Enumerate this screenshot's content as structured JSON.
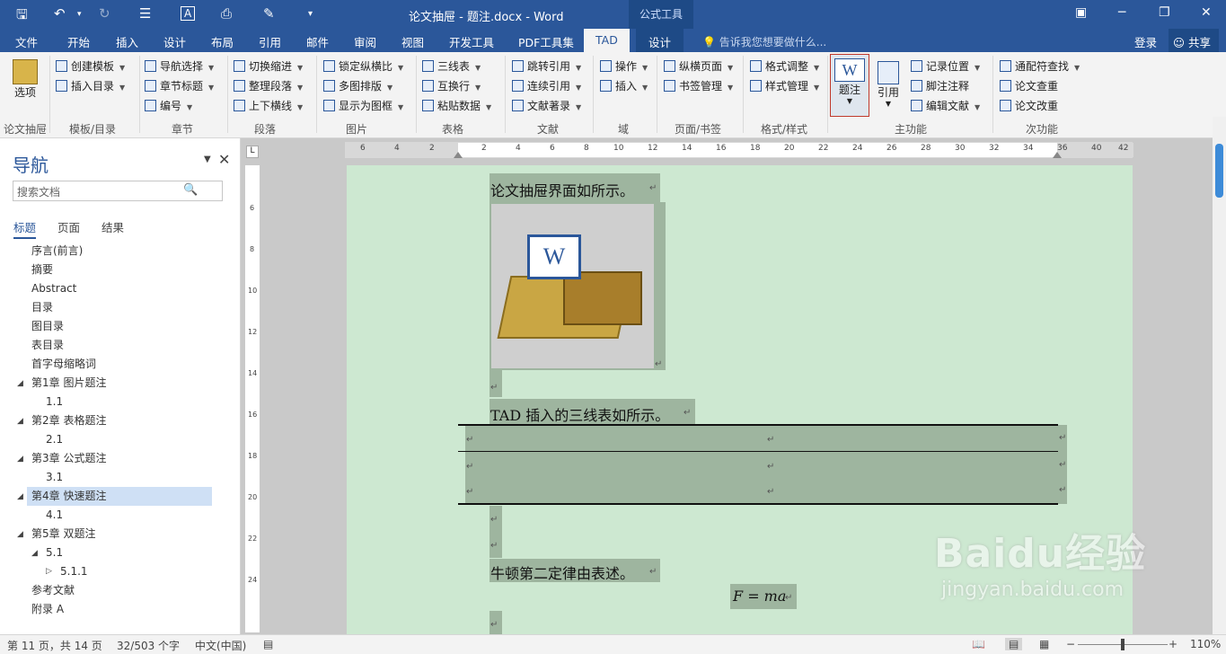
{
  "titlebar": {
    "document_title": "论文抽屉 - 题注.docx - Word",
    "context_group": "公式工具"
  },
  "tabs": [
    "文件",
    "开始",
    "插入",
    "设计",
    "布局",
    "引用",
    "邮件",
    "审阅",
    "视图",
    "开发工具",
    "PDF工具集",
    "TAD",
    "设计"
  ],
  "active_tab": "TAD",
  "tell_me": "告诉我您想要做什么...",
  "account": {
    "login": "登录",
    "share": "共享"
  },
  "ribbon": {
    "groups": [
      "论文抽屉",
      "模板/目录",
      "章节",
      "段落",
      "图片",
      "表格",
      "文献",
      "域",
      "页面/书签",
      "格式/样式",
      "主功能",
      "次功能"
    ],
    "options_btn": "选项",
    "items": {
      "create_template": "创建模板",
      "insert_toc": "插入目录",
      "nav_select": "导航选择",
      "chapter_title": "章节标题",
      "numbering": "编号",
      "switch_indent": "切换缩进",
      "arrange_para": "整理段落",
      "hline": "上下横线",
      "lock_ratio": "锁定纵横比",
      "multi_image": "多图排版",
      "show_frame": "显示为图框",
      "three_line": "三线表",
      "alt_row": "互换行",
      "paste_data": "粘贴数据",
      "jump_ref": "跳转引用",
      "cont_ref": "连续引用",
      "bib": "文献著录",
      "operate": "操作",
      "insert": "插入",
      "landscape": "纵横页面",
      "bookmark": "书签管理",
      "format_adjust": "格式调整",
      "style_manage": "样式管理",
      "caption": "题注",
      "cite": "引用",
      "record_pos": "记录位置",
      "footnote": "脚注注释",
      "edit_ref": "编辑文献",
      "wildcard_find": "通配符查找",
      "check": "论文查重",
      "revise": "论文改重"
    },
    "ic_letters": {
      "caption": "W",
      "landscape": "纵"
    }
  },
  "nav": {
    "title": "导航",
    "search_placeholder": "搜索文档",
    "tabs": [
      "标题",
      "页面",
      "结果"
    ],
    "items": [
      {
        "label": "序言(前言)"
      },
      {
        "label": "摘要"
      },
      {
        "label": "Abstract"
      },
      {
        "label": "目录"
      },
      {
        "label": "图目录"
      },
      {
        "label": "表目录"
      },
      {
        "label": "首字母缩略词"
      },
      {
        "label": "第1章 图片题注"
      },
      {
        "label": "1.1"
      },
      {
        "label": "第2章 表格题注"
      },
      {
        "label": "2.1"
      },
      {
        "label": "第3章 公式题注"
      },
      {
        "label": "3.1"
      },
      {
        "label": "第4章 快速题注"
      },
      {
        "label": "4.1"
      },
      {
        "label": "第5章 双题注"
      },
      {
        "label": "5.1"
      },
      {
        "label": "5.1.1"
      },
      {
        "label": "参考文献"
      },
      {
        "label": "附录 A"
      }
    ]
  },
  "ruler": {
    "h_labels": [
      "6",
      "4",
      "2",
      "2",
      "4",
      "6",
      "8",
      "10",
      "12",
      "14",
      "16",
      "18",
      "20",
      "22",
      "24",
      "26",
      "28",
      "30",
      "32",
      "34",
      "36",
      "40",
      "42"
    ],
    "v_labels": [
      "6",
      "8",
      "10",
      "12",
      "14",
      "16",
      "18",
      "20",
      "22",
      "24"
    ]
  },
  "document": {
    "line1": "论文抽屉界面如所示。",
    "line2": "TAD 插入的三线表如所示。",
    "line3": "牛顿第二定律由表述。",
    "formula": "F = ma",
    "para_mark": "↵",
    "image_badge": "W"
  },
  "status": {
    "page": "第 11 页，共 14 页",
    "words": "32/503 个字",
    "lang": "中文(中国)",
    "zoom": "110%"
  },
  "watermark": {
    "brand": "Baidu经验",
    "url": "jingyan.baidu.com"
  }
}
